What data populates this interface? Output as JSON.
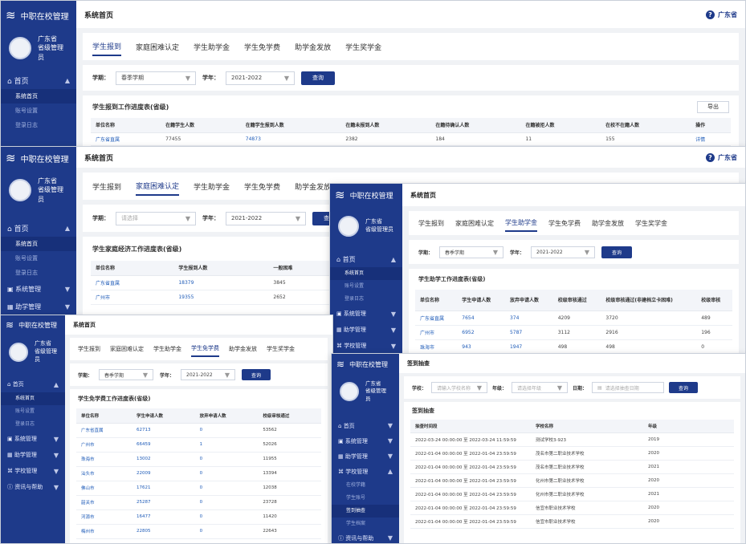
{
  "app": {
    "brand": "中职在校管理",
    "province": "广东省",
    "role": "省级管理员",
    "help": "广东省",
    "help_short": "广东省",
    "page_title": "系统首页"
  },
  "menu": {
    "home": "首页",
    "home_sub": [
      "系统首页",
      "账号设置",
      "登录日志"
    ],
    "system": "系统管理",
    "aid": "助学管理",
    "school": "学校管理",
    "school_sub": [
      "在校学籍",
      "学生账号",
      "签到抽查",
      "学生档案"
    ],
    "info": "资讯与帮助"
  },
  "tabs": [
    "学生报到",
    "家庭困难认定",
    "学生助学金",
    "学生免学费",
    "助学金发放",
    "学生奖学金"
  ],
  "filters": {
    "term_label": "学期：",
    "term_value": "春季学期",
    "term_placeholder": "请选择",
    "year_label": "学年：",
    "year_value": "2021-2022",
    "query": "查询"
  },
  "win1": {
    "section": "学生报到工作进度表(省级)",
    "export": "导出",
    "headers": [
      "单位名称",
      "在籍学生人数",
      "在籍学生报到人数",
      "在籍未报到人数",
      "在籍待确认人数",
      "在籍被拒人数",
      "在校不在籍人数",
      "操作"
    ],
    "row": [
      "广东省直属",
      "77455",
      "74873",
      "2382",
      "184",
      "11",
      "155",
      "详情"
    ]
  },
  "win2": {
    "section": "学生家庭经济工作进度表(省级)",
    "headers": [
      "单位名称",
      "学生报到人数",
      "一般困难"
    ],
    "rows": [
      [
        "广东省直属",
        "18379",
        "3845"
      ],
      [
        "广州市",
        "19355",
        "2652"
      ]
    ]
  },
  "win3": {
    "section": "学生助学工作进度表(省级)",
    "headers": [
      "单位名称",
      "学生申请人数",
      "放弃申请人数",
      "校级审核通过",
      "校级审核通过(非建档立卡困难)",
      "校级审核"
    ],
    "rows": [
      [
        "广东省直属",
        "7654",
        "374",
        "4209",
        "3720",
        "489"
      ],
      [
        "广州市",
        "6952",
        "5787",
        "3112",
        "2916",
        "196"
      ],
      [
        "珠海市",
        "943",
        "1947",
        "498",
        "498",
        "0"
      ]
    ]
  },
  "win4": {
    "section": "学生免学费工作进度表(省级)",
    "headers": [
      "单位名称",
      "学生申请人数",
      "放弃申请人数",
      "校级审核通过"
    ],
    "rows": [
      [
        "广东省直属",
        "62713",
        "0",
        "53562"
      ],
      [
        "广州市",
        "66459",
        "1",
        "52026"
      ],
      [
        "珠海市",
        "13002",
        "0",
        "11955"
      ],
      [
        "汕头市",
        "22009",
        "0",
        "13394"
      ],
      [
        "佛山市",
        "17621",
        "0",
        "12038"
      ],
      [
        "韶关市",
        "25287",
        "0",
        "23728"
      ],
      [
        "河源市",
        "16477",
        "0",
        "11420"
      ],
      [
        "梅州市",
        "22805",
        "0",
        "22643"
      ]
    ]
  },
  "win5": {
    "page_title": "签到抽查",
    "school_label": "学校：",
    "school_placeholder": "请输入学校名称",
    "grade_label": "年级：",
    "grade_placeholder": "请选择年级",
    "date_label": "日期：",
    "date_placeholder": "请选择抽查日期",
    "query": "查询",
    "section": "签到抽查",
    "headers": [
      "抽查时间段",
      "学校名称",
      "年级"
    ],
    "rows": [
      [
        "2022-03-24 00:00:00 至 2022-03-24 11:59:59",
        "测试学校3-923",
        "2019"
      ],
      [
        "2022-01-04 00:00:00 至 2022-01-04 23:59:59",
        "茂名市第二职业技术学校",
        "2020"
      ],
      [
        "2022-01-04 00:00:00 至 2022-01-04 23:59:59",
        "茂名市第二职业技术学校",
        "2021"
      ],
      [
        "2022-01-04 00:00:00 至 2022-01-04 23:59:59",
        "化州市第二职业技术学校",
        "2020"
      ],
      [
        "2022-01-04 00:00:00 至 2022-01-04 23:59:59",
        "化州市第二职业技术学校",
        "2021"
      ],
      [
        "2022-01-04 00:00:00 至 2022-01-04 23:59:59",
        "信宜市职业技术学校",
        "2020"
      ],
      [
        "2022-01-04 00:00:00 至 2022-01-04 23:59:59",
        "信宜市职业技术学校",
        "2020"
      ]
    ]
  },
  "colors": {
    "primary": "#1e3a8a",
    "link": "#1e5bb8",
    "background": "#f0f2f5"
  }
}
